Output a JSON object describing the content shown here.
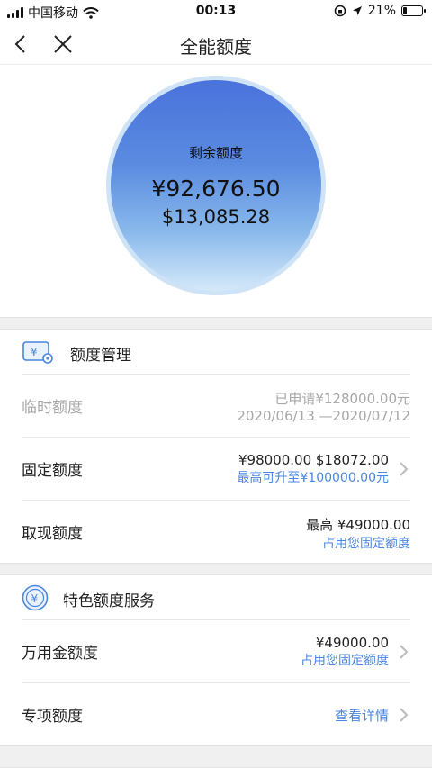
{
  "status_bar": {
    "carrier": "中国移动",
    "time": "00:13",
    "battery": "21%",
    "battery_level": 0.21
  },
  "nav": {
    "title": "全能额度"
  },
  "balance": {
    "label": "剩余额度",
    "cny": "¥92,676.50",
    "usd": "$13,085.28"
  },
  "quota_management": {
    "title": "额度管理",
    "rows": [
      {
        "label": "临时额度",
        "line1": "已申请¥128000.00元",
        "line2": "2020/06/13 —2020/07/12",
        "disabled": true
      },
      {
        "label": "固定额度",
        "line1": "¥98000.00 $18072.00",
        "line2": "最高可升至¥100000.00元"
      },
      {
        "label": "取现额度",
        "line1": "最高 ¥49000.00",
        "line2": "占用您固定额度"
      }
    ]
  },
  "special_service": {
    "title": "特色额度服务",
    "rows": [
      {
        "label": "万用金额度",
        "line1": "¥49000.00",
        "line2": "占用您固定额度"
      },
      {
        "label": "专项额度",
        "link": "查看详情"
      }
    ]
  },
  "colors": {
    "accent": "#4a86e0",
    "circle_top": "#4a72dc",
    "circle_bottom": "#d4e9f9"
  },
  "icons": [
    "back-arrow-icon",
    "close-icon",
    "quota-card-gear-icon",
    "yen-coin-icon",
    "chevron-right-icon",
    "wifi-icon",
    "location-arrow-icon",
    "orientation-lock-icon"
  ]
}
